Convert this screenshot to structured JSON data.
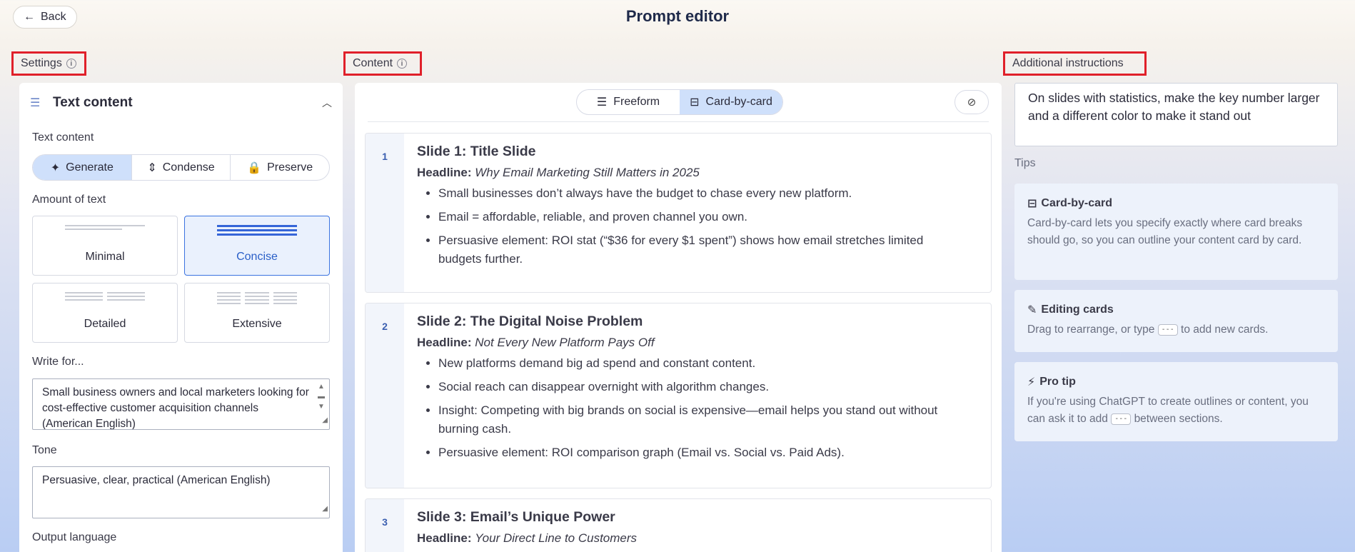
{
  "header": {
    "back_label": "Back",
    "title": "Prompt editor"
  },
  "sections": {
    "settings": "Settings",
    "content": "Content",
    "additional": "Additional instructions"
  },
  "settings": {
    "panel_title": "Text content",
    "text_content_label": "Text content",
    "text_modes": [
      "Generate",
      "Condense",
      "Preserve"
    ],
    "text_mode_selected": "Generate",
    "amount_label": "Amount of text",
    "amount_options": [
      "Minimal",
      "Concise",
      "Detailed",
      "Extensive"
    ],
    "amount_selected": "Concise",
    "write_for_label": "Write for...",
    "write_for_value": "Small business owners and local marketers looking for cost-effective customer acquisition channels (American English)",
    "tone_label": "Tone",
    "tone_value": "Persuasive, clear, practical (American English)",
    "output_language_label": "Output language"
  },
  "content": {
    "views": [
      "Freeform",
      "Card-by-card"
    ],
    "view_selected": "Card-by-card",
    "cards": [
      {
        "num": "1",
        "title": "Slide 1: Title Slide",
        "headline_label": "Headline:",
        "headline": "Why Email Marketing Still Matters in 2025",
        "bullets": [
          "Small businesses don’t always have the budget to chase every new platform.",
          "Email = affordable, reliable, and proven channel you own.",
          "Persuasive element: ROI stat (“$36 for every $1 spent”) shows how email stretches limited budgets further."
        ]
      },
      {
        "num": "2",
        "title": "Slide 2: The Digital Noise Problem",
        "headline_label": "Headline:",
        "headline": "Not Every New Platform Pays Off",
        "bullets": [
          "New platforms demand big ad spend and constant content.",
          "Social reach can disappear overnight with algorithm changes.",
          "Insight: Competing with big brands on social is expensive—email helps you stand out without burning cash.",
          "Persuasive element: ROI comparison graph (Email vs. Social vs. Paid Ads)."
        ]
      },
      {
        "num": "3",
        "title": "Slide 3: Email’s Unique Power",
        "headline_label": "Headline:",
        "headline": "Your Direct Line to Customers"
      }
    ]
  },
  "additional": {
    "instructions": "On slides with statistics, make the key number larger and a different color to make it stand out",
    "tips_label": "Tips",
    "tips": [
      {
        "title": "Card-by-card",
        "body": "Card-by-card lets you specify exactly where card breaks should go, so you can outline your content card by card."
      },
      {
        "title": "Editing cards",
        "body_pre": "Drag to rearrange, or type",
        "kbd": "---",
        "body_post": "to add new cards."
      },
      {
        "title": "Pro tip",
        "body_pre": "If you're using ChatGPT to create outlines or content, you can ask it to add",
        "kbd": "---",
        "body_post": "between sections."
      }
    ]
  },
  "colors": {
    "accent": "#3b73e0",
    "selected_bg": "#cfe0fb",
    "highlight_box": "#e0202a"
  }
}
